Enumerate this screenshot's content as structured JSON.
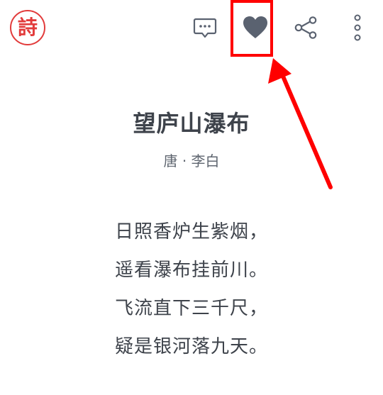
{
  "app": {
    "logo_text": "詩"
  },
  "toolbar": {
    "icons": [
      "comment-icon",
      "heart-icon",
      "share-icon",
      "more-vertical-icon"
    ],
    "icon_color": "#5a6270"
  },
  "annotation": {
    "color": "#ff0000"
  },
  "poem": {
    "title": "望庐山瀑布",
    "dynasty": "唐",
    "separator": "·",
    "author": "李白",
    "lines": [
      "日照香炉生紫烟，",
      "遥看瀑布挂前川。",
      "飞流直下三千尺，",
      "疑是银河落九天。"
    ]
  }
}
